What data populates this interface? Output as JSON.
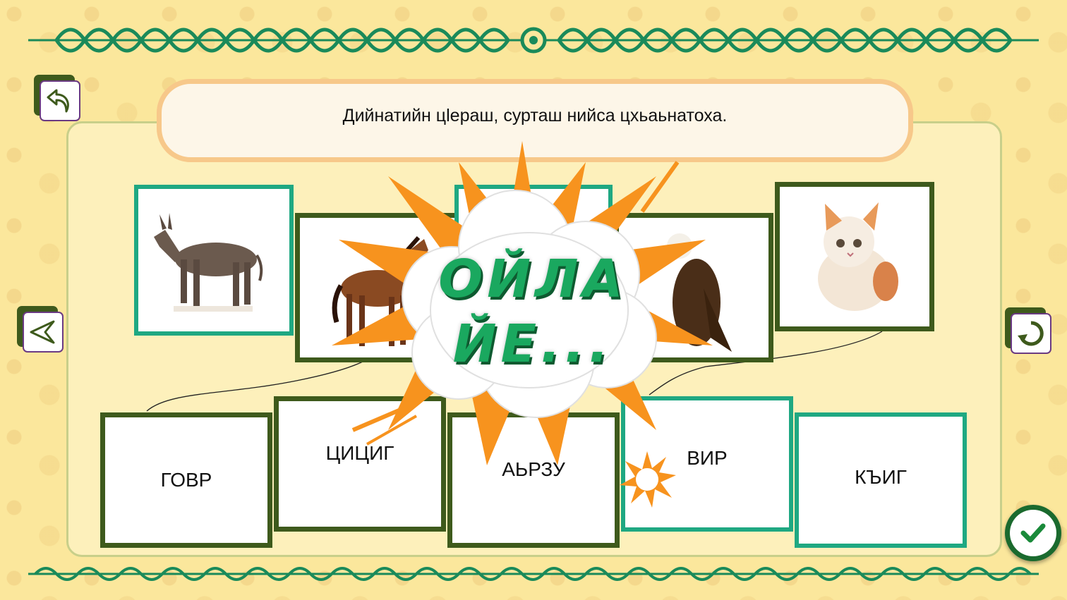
{
  "instruction": "Дийнатийн цlераш, сурташ нийса цхьаьнатоха.",
  "overlay_text": [
    "ОЙЛА",
    "ЙЕ..."
  ],
  "pictures": [
    {
      "name": "donkey-card",
      "icon": "donkey-image"
    },
    {
      "name": "horse-card",
      "icon": "horse-image"
    },
    {
      "name": "hidden-card",
      "icon": "hidden-image"
    },
    {
      "name": "eagle-card",
      "icon": "eagle-image"
    },
    {
      "name": "kitten-card",
      "icon": "kitten-image"
    }
  ],
  "words": [
    "ГОВР",
    "ЦИЦИГ",
    "АЬРЗУ",
    "ВИР",
    "КЪИГ"
  ],
  "buttons": {
    "back": "back-arrow-icon",
    "prev": "navigate-left-icon",
    "reset": "reset-icon",
    "check": "check-icon"
  },
  "colors": {
    "accent_green": "#1fa882",
    "olive": "#3e5a1c",
    "burst_orange": "#f7931e",
    "text_green": "#1aa85f"
  }
}
